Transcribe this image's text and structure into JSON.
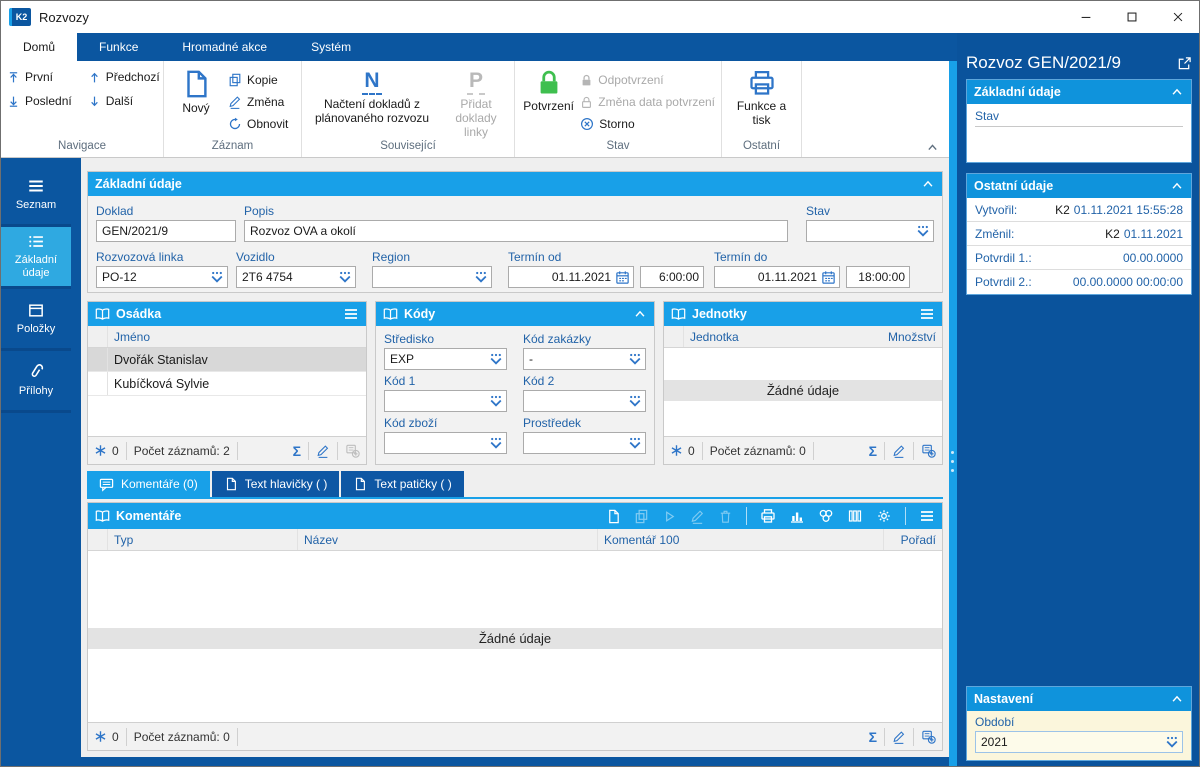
{
  "titlebar": {
    "logo": "K2",
    "title": "Rozvozy"
  },
  "ribbon": {
    "tabs": {
      "domu": "Domů",
      "funkce": "Funkce",
      "hromadne": "Hromadné akce",
      "system": "Systém"
    },
    "navigace": {
      "label": "Navigace",
      "prvni": "První",
      "predchozi": "Předchozí",
      "posledni": "Poslední",
      "dalsi": "Další"
    },
    "zaznam": {
      "label": "Záznam",
      "novy": "Nový",
      "kopie": "Kopie",
      "zmena": "Změna",
      "obnovit": "Obnovit"
    },
    "souvisejici": {
      "label": "Související",
      "nacteni": "Načtení dokladů z plánovaného rozvozu",
      "pridat": "Přidat doklady linky",
      "n": "N",
      "p": "P"
    },
    "stav": {
      "label": "Stav",
      "potvrzeni": "Potvrzení",
      "odpotvrzeni": "Odpotvrzení",
      "zmena_data": "Změna data potvrzení",
      "storno": "Storno"
    },
    "ostatni": {
      "label": "Ostatní",
      "funkce_tisk": "Funkce a tisk"
    }
  },
  "sidebar": {
    "seznam": "Seznam",
    "zakladni": "Základní údaje",
    "polozky": "Položky",
    "prilohy": "Přílohy"
  },
  "form": {
    "header": "Základní údaje",
    "doklad": {
      "label": "Doklad",
      "value": "GEN/2021/9"
    },
    "popis": {
      "label": "Popis",
      "value": "Rozvoz OVA a okolí"
    },
    "stav": {
      "label": "Stav",
      "value": ""
    },
    "linka": {
      "label": "Rozvozová linka",
      "value": "PO-12"
    },
    "vozidlo": {
      "label": "Vozidlo",
      "value": "2T6 4754"
    },
    "region": {
      "label": "Region",
      "value": ""
    },
    "termin_od": {
      "label": "Termín od",
      "date": "01.11.2021",
      "time": "6:00:00"
    },
    "termin_do": {
      "label": "Termín do",
      "date": "01.11.2021",
      "time": "18:00:00"
    }
  },
  "osadka": {
    "header": "Osádka",
    "col_jmeno": "Jméno",
    "rows": [
      "Dvořák Stanislav",
      "Kubíčková Sylvie"
    ],
    "footer": {
      "marked": "0",
      "count": "Počet záznamů: 2"
    }
  },
  "kody": {
    "header": "Kódy",
    "stredisko": {
      "label": "Středisko",
      "value": "EXP"
    },
    "kod_zakazky": {
      "label": "Kód zakázky",
      "value": "-"
    },
    "kod1": {
      "label": "Kód 1",
      "value": ""
    },
    "kod2": {
      "label": "Kód 2",
      "value": ""
    },
    "kod_zbozi": {
      "label": "Kód zboží",
      "value": ""
    },
    "prostredek": {
      "label": "Prostředek",
      "value": ""
    }
  },
  "jednotky": {
    "header": "Jednotky",
    "col_jednotka": "Jednotka",
    "col_mnozstvi": "Množství",
    "empty": "Žádné údaje",
    "footer": {
      "marked": "0",
      "count": "Počet záznamů: 0"
    }
  },
  "doctabs": {
    "komentare": "Komentáře (0)",
    "hlavicka": "Text hlavičky ( )",
    "paticka": "Text patičky ( )"
  },
  "komentare": {
    "header": "Komentáře",
    "cols": {
      "typ": "Typ",
      "nazev": "Název",
      "komentar": "Komentář 100",
      "poradi": "Pořadí"
    },
    "empty": "Žádné údaje",
    "footer": {
      "marked": "0",
      "count": "Počet záznamů: 0"
    }
  },
  "panel": {
    "title": "Rozvoz GEN/2021/9",
    "zakladni": {
      "header": "Základní údaje",
      "stav_label": "Stav"
    },
    "ostatni": {
      "header": "Ostatní údaje",
      "rows": [
        {
          "label": "Vytvořil:",
          "user": "K2",
          "value": "01.11.2021 15:55:28"
        },
        {
          "label": "Změnil:",
          "user": "K2",
          "value": "01.11.2021"
        },
        {
          "label": "Potvrdil 1.:",
          "user": "",
          "value": "00.00.0000"
        },
        {
          "label": "Potvrdil 2.:",
          "user": "",
          "value": "00.00.0000 00:00:00"
        }
      ]
    },
    "nastaveni": {
      "header": "Nastavení",
      "obdobi_label": "Období",
      "obdobi_value": "2021"
    }
  },
  "colors": {
    "navy": "#0B56A0",
    "header_blue": "#18A0E8",
    "sidebar_active": "#2FA9E1",
    "label_blue": "#2263A8",
    "icon_blue": "#2E75C8",
    "lock_green": "#3FBF4F",
    "settings_bg": "#FBF6DC"
  },
  "icons": [
    "k2-logo",
    "minimize-icon",
    "maximize-icon",
    "close-icon",
    "arrow-first-icon",
    "arrow-prev-icon",
    "arrow-last-icon",
    "arrow-next-icon",
    "new-document-icon",
    "copy-icon",
    "pencil-icon",
    "refresh-icon",
    "letter-n-icon",
    "letter-p-icon",
    "lock-green-icon",
    "lock-gray-icon",
    "storno-circle-x-icon",
    "printer-icon",
    "hamburger-icon",
    "list-icon",
    "box-icon",
    "paperclip-icon",
    "book-icon",
    "chevron-up-icon",
    "dropdown-icon",
    "calendar-icon",
    "asterisk-icon",
    "sigma-icon",
    "table-add-icon",
    "comment-bubble-icon",
    "document-icon",
    "play-icon",
    "trash-icon",
    "bar-chart-icon",
    "clover-icon",
    "columns-icon",
    "gear-icon",
    "external-link-icon"
  ]
}
